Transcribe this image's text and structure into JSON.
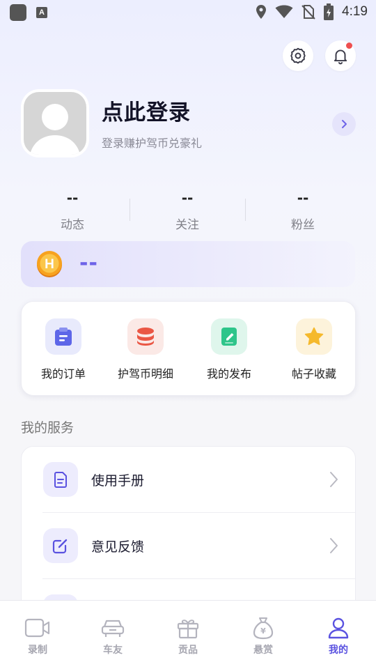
{
  "status_bar": {
    "time": "4:19",
    "icons": [
      "location-icon",
      "wifi-icon",
      "no-sim-icon",
      "battery-icon"
    ]
  },
  "header": {
    "settings_icon": "gear-icon",
    "bell_icon": "bell-icon",
    "has_notification": true
  },
  "profile": {
    "title": "点此登录",
    "subtitle": "登录赚护驾币兑豪礼"
  },
  "stats": [
    {
      "value": "--",
      "label": "动态"
    },
    {
      "value": "--",
      "label": "关注"
    },
    {
      "value": "--",
      "label": "粉丝"
    }
  ],
  "coins": {
    "value": "--",
    "icon": "coin-h-icon"
  },
  "quick_actions": [
    {
      "label": "我的订单",
      "icon": "clipboard-icon",
      "color": "#5d66e8",
      "bg": "#e8eafc"
    },
    {
      "label": "护驾币明细",
      "icon": "coins-stack-icon",
      "color": "#ea5644",
      "bg": "#fbe9e6"
    },
    {
      "label": "我的发布",
      "icon": "note-edit-icon",
      "color": "#2ec58a",
      "bg": "#dff6ec"
    },
    {
      "label": "帖子收藏",
      "icon": "star-icon",
      "color": "#f5b92c",
      "bg": "#fdf3db"
    }
  ],
  "services": {
    "title": "我的服务",
    "items": [
      {
        "label": "使用手册",
        "icon": "manual-icon"
      },
      {
        "label": "意见反馈",
        "icon": "feedback-edit-icon"
      }
    ]
  },
  "bottom_nav": {
    "items": [
      {
        "label": "录制",
        "icon": "video-camera-icon",
        "active": false
      },
      {
        "label": "车友",
        "icon": "car-icon",
        "active": false
      },
      {
        "label": "贡品",
        "icon": "gift-icon",
        "active": false
      },
      {
        "label": "悬赏",
        "icon": "money-bag-icon",
        "active": false
      },
      {
        "label": "我的",
        "icon": "person-icon",
        "active": true
      }
    ]
  },
  "colors": {
    "accent": "#5a52e0",
    "inactive": "#a6a6b0",
    "badge": "#ee4f4f"
  }
}
